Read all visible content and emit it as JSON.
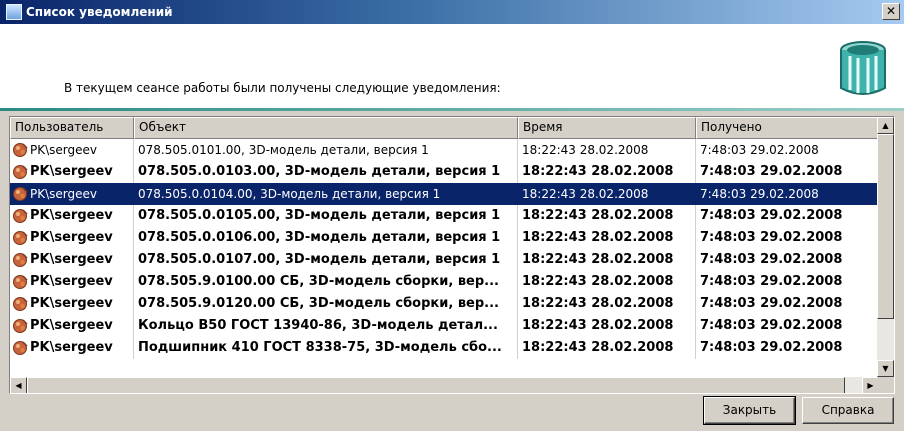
{
  "window": {
    "title": "Список уведомлений",
    "close_glyph": "✕"
  },
  "header": {
    "message": "В текущем сеансе работы были получены следующие уведомления:",
    "icon": "notification-bin-icon"
  },
  "columns": [
    "Пользователь",
    "Объект",
    "Время",
    "Получено"
  ],
  "rows": [
    {
      "user": "PK\\sergeev",
      "object": "078.505.0101.00, 3D-модель детали, версия 1",
      "time": "18:22:43 28.02.2008",
      "received": "7:48:03 29.02.2008",
      "bold": false,
      "selected": false
    },
    {
      "user": "PK\\sergeev",
      "object": "078.505.0.0103.00, 3D-модель детали, версия 1",
      "time": "18:22:43 28.02.2008",
      "received": "7:48:03 29.02.2008",
      "bold": true,
      "selected": false
    },
    {
      "user": "PK\\sergeev",
      "object": "078.505.0.0104.00, 3D-модель детали, версия 1",
      "time": "18:22:43 28.02.2008",
      "received": "7:48:03 29.02.2008",
      "bold": false,
      "selected": true
    },
    {
      "user": "PK\\sergeev",
      "object": "078.505.0.0105.00, 3D-модель детали, версия 1",
      "time": "18:22:43 28.02.2008",
      "received": "7:48:03 29.02.2008",
      "bold": true,
      "selected": false
    },
    {
      "user": "PK\\sergeev",
      "object": "078.505.0.0106.00, 3D-модель детали, версия 1",
      "time": "18:22:43 28.02.2008",
      "received": "7:48:03 29.02.2008",
      "bold": true,
      "selected": false
    },
    {
      "user": "PK\\sergeev",
      "object": "078.505.0.0107.00, 3D-модель детали, версия 1",
      "time": "18:22:43 28.02.2008",
      "received": "7:48:03 29.02.2008",
      "bold": true,
      "selected": false
    },
    {
      "user": "PK\\sergeev",
      "object": "078.505.9.0100.00 СБ, 3D-модель сборки, вер...",
      "time": "18:22:43 28.02.2008",
      "received": "7:48:03 29.02.2008",
      "bold": true,
      "selected": false
    },
    {
      "user": "PK\\sergeev",
      "object": "078.505.9.0120.00 СБ, 3D-модель сборки, вер...",
      "time": "18:22:43 28.02.2008",
      "received": "7:48:03 29.02.2008",
      "bold": true,
      "selected": false
    },
    {
      "user": "PK\\sergeev",
      "object": "Кольцо В50 ГОСТ 13940-86, 3D-модель детал...",
      "time": "18:22:43 28.02.2008",
      "received": "7:48:03 29.02.2008",
      "bold": true,
      "selected": false
    },
    {
      "user": "PK\\sergeev",
      "object": "Подшипник 410 ГОСТ 8338-75, 3D-модель сбо...",
      "time": "18:22:43 28.02.2008",
      "received": "7:48:03 29.02.2008",
      "bold": true,
      "selected": false
    }
  ],
  "buttons": {
    "close": "Закрыть",
    "help": "Справка"
  },
  "colors": {
    "selection": "#0a246a",
    "title_gradient_start": "#0a246a",
    "accent": "#2a8a82"
  }
}
